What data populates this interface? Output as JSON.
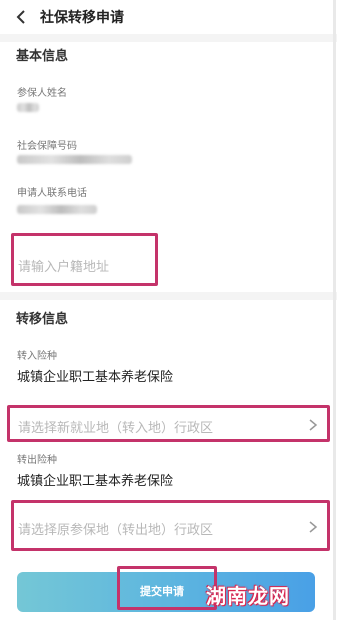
{
  "header": {
    "title": "社保转移申请"
  },
  "basic": {
    "section_title": "基本信息",
    "name_label": "参保人姓名",
    "ssn_label": "社会保障号码",
    "phone_label": "申请人联系电话",
    "address_placeholder": "请输入户籍地址"
  },
  "transfer": {
    "section_title": "转移信息",
    "in_label": "转入险种",
    "in_value": "城镇企业职工基本养老保险",
    "in_region_placeholder": "请选择新就业地（转入地）行政区",
    "out_label": "转出险种",
    "out_value": "城镇企业职工基本养老保险",
    "out_region_placeholder": "请选择原参保地（转出地）行政区"
  },
  "actions": {
    "submit_label": "提交申请"
  },
  "watermark": "湖南龙网",
  "colors": {
    "highlight": "#c4336a",
    "button_start": "#74c7d6",
    "button_end": "#49a0e6"
  }
}
